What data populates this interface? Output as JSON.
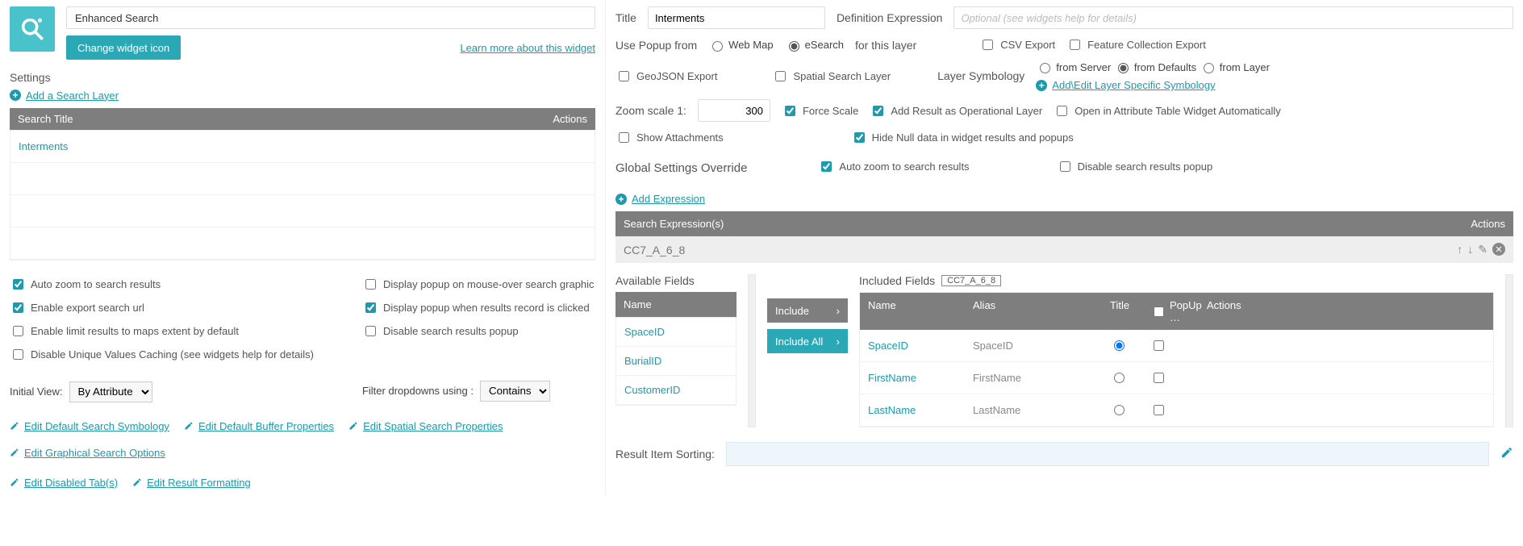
{
  "widget": {
    "name": "Enhanced Search",
    "change_icon": "Change widget icon",
    "learn_more": "Learn more about this widget"
  },
  "left": {
    "settings_label": "Settings",
    "add_search_layer": "Add a Search Layer",
    "tbl_title": "Search Title",
    "tbl_actions": "Actions",
    "row1": "Interments",
    "chk_autozoom": "Auto zoom to search results",
    "chk_exporturl": "Enable export search url",
    "chk_limitextent": "Enable limit results to maps extent by default",
    "chk_disablecache": "Disable Unique Values Caching (see widgets help for details)",
    "chk_popup_mouse": "Display popup on mouse-over search graphic",
    "chk_popup_click": "Display popup when results record is clicked",
    "chk_disable_popup": "Disable search results popup",
    "initial_view_label": "Initial View:",
    "initial_view_value": "By Attribute",
    "filter_label": "Filter dropdowns using :",
    "filter_value": "Contains",
    "edit_links": {
      "a": "Edit Default Search Symbology",
      "b": "Edit Default Buffer Properties",
      "c": "Edit Spatial Search Properties",
      "d": "Edit Graphical Search Options",
      "e": "Edit Disabled Tab(s)",
      "f": "Edit Result Formatting"
    }
  },
  "right": {
    "title_label": "Title",
    "title_value": "Interments",
    "def_expr_label": "Definition Expression",
    "def_expr_placeholder": "Optional (see widgets help for details)",
    "use_popup_from": "Use Popup from",
    "radio_webmap": "Web Map",
    "radio_esearch": "eSearch",
    "for_this_layer": "for this layer",
    "csv": "CSV Export",
    "fce": "Feature Collection Export",
    "geojson": "GeoJSON Export",
    "ssl": "Spatial Search Layer",
    "layer_symb": "Layer Symbology",
    "from_server": "from Server",
    "from_defaults": "from Defaults",
    "from_layer": "from Layer",
    "add_edit_symb": "Add\\Edit Layer Specific Symbology",
    "zoom_scale": "Zoom scale 1:",
    "zoom_val": "300",
    "force_scale": "Force Scale",
    "add_result_op": "Add Result as Operational Layer",
    "open_attr": "Open in Attribute Table Widget Automatically",
    "show_attach": "Show Attachments",
    "hide_null": "Hide Null data in widget results and popups",
    "gso": "Global Settings Override",
    "autozoom2": "Auto zoom to search results",
    "disable_popup2": "Disable search results popup",
    "add_expr": "Add Expression",
    "expr_hdr": "Search Expression(s)",
    "expr_actions": "Actions",
    "expr_name": "CC7_A_6_8",
    "avail_fields": "Available Fields",
    "include": "Include",
    "include_all": "Include All",
    "included_fields": "Included Fields",
    "tag": "CC7_A_6_8",
    "col_name": "Name",
    "col_alias": "Alias",
    "col_title": "Title",
    "col_popup": "PopUp …",
    "col_actions": "Actions",
    "avail": {
      "a": "SpaceID",
      "b": "BurialID",
      "c": "CustomerID"
    },
    "inc": {
      "r1n": "SpaceID",
      "r1a": "SpaceID",
      "r2n": "FirstName",
      "r2a": "FirstName",
      "r3n": "LastName",
      "r3a": "LastName"
    },
    "result_sort": "Result Item Sorting:"
  }
}
